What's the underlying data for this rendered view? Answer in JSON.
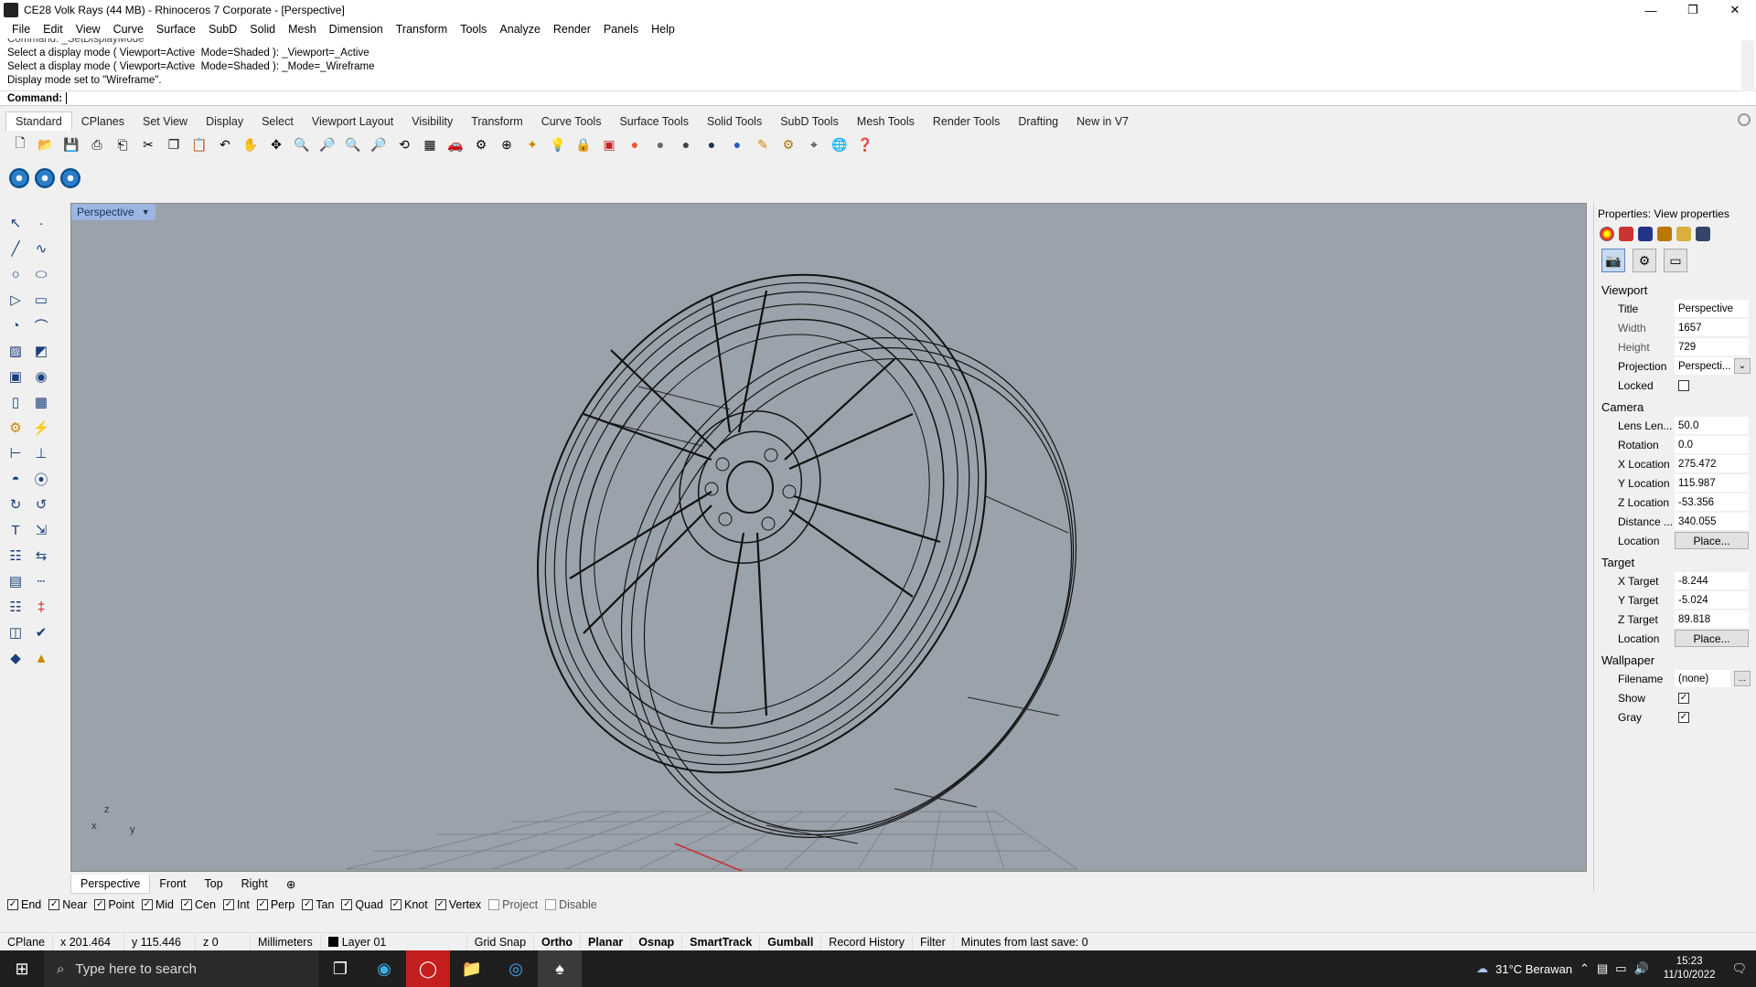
{
  "window": {
    "title": "CE28 Volk Rays (44 MB) - Rhinoceros 7 Corporate - [Perspective]",
    "minimize_icon": "minimize-icon",
    "maximize_icon": "restore-icon",
    "close_icon": "close-icon"
  },
  "menu": [
    "File",
    "Edit",
    "View",
    "Curve",
    "Surface",
    "SubD",
    "Solid",
    "Mesh",
    "Dimension",
    "Transform",
    "Tools",
    "Analyze",
    "Render",
    "Panels",
    "Help"
  ],
  "command_history": {
    "line0": "Command: _SetDisplayMode",
    "line1": "Select a display mode ( Viewport=Active  Mode=Shaded ): _Viewport=_Active",
    "line2": "Select a display mode ( Viewport=Active  Mode=Shaded ): _Mode=_Wireframe",
    "line3": "Display mode set to \"Wireframe\"."
  },
  "command_prompt": {
    "label": "Command:",
    "value": ""
  },
  "toolbar_tabs": [
    "Standard",
    "CPlanes",
    "Set View",
    "Display",
    "Select",
    "Viewport Layout",
    "Visibility",
    "Transform",
    "Curve Tools",
    "Surface Tools",
    "Solid Tools",
    "SubD Tools",
    "Mesh Tools",
    "Render Tools",
    "Drafting",
    "New in V7"
  ],
  "viewport": {
    "title": "Perspective",
    "display_mode": "Wireframe",
    "axes": {
      "z": "z",
      "x": "x",
      "y": "y"
    }
  },
  "view_tabs": [
    "Perspective",
    "Front",
    "Top",
    "Right"
  ],
  "osnaps": [
    {
      "label": "End",
      "checked": true
    },
    {
      "label": "Near",
      "checked": true
    },
    {
      "label": "Point",
      "checked": true
    },
    {
      "label": "Mid",
      "checked": true
    },
    {
      "label": "Cen",
      "checked": true
    },
    {
      "label": "Int",
      "checked": true
    },
    {
      "label": "Perp",
      "checked": true
    },
    {
      "label": "Tan",
      "checked": true
    },
    {
      "label": "Quad",
      "checked": true
    },
    {
      "label": "Knot",
      "checked": true
    },
    {
      "label": "Vertex",
      "checked": true
    },
    {
      "label": "Project",
      "checked": false
    },
    {
      "label": "Disable",
      "checked": false
    }
  ],
  "status": {
    "cplane": "CPlane",
    "x": "x 201.464",
    "y": "y 115.446",
    "z": "z 0",
    "units": "Millimeters",
    "layer": "Layer 01",
    "grid_snap": "Grid Snap",
    "ortho": "Ortho",
    "planar": "Planar",
    "osnap": "Osnap",
    "smarttrack": "SmartTrack",
    "gumball": "Gumball",
    "record_history": "Record History",
    "filter": "Filter",
    "save_info": "Minutes from last save: 0"
  },
  "properties": {
    "title": "Properties: View properties",
    "viewport_section": "Viewport",
    "title_label": "Title",
    "title_value": "Perspective",
    "width_label": "Width",
    "width_value": "1657",
    "height_label": "Height",
    "height_value": "729",
    "projection_label": "Projection",
    "projection_value": "Perspecti...",
    "locked_label": "Locked",
    "locked": false,
    "camera_section": "Camera",
    "lens_label": "Lens Len...",
    "lens_value": "50.0",
    "rotation_label": "Rotation",
    "rotation_value": "0.0",
    "xloc_label": "X Location",
    "xloc_value": "275.472",
    "yloc_label": "Y Location",
    "yloc_value": "115.987",
    "zloc_label": "Z Location",
    "zloc_value": "-53.356",
    "distance_label": "Distance ...",
    "distance_value": "340.055",
    "location_label": "Location",
    "place_button": "Place...",
    "target_section": "Target",
    "xtarget_label": "X Target",
    "xtarget_value": "-8.244",
    "ytarget_label": "Y Target",
    "ytarget_value": "-5.024",
    "ztarget_label": "Z Target",
    "ztarget_value": "89.818",
    "target_location_label": "Location",
    "target_place_button": "Place...",
    "wallpaper_section": "Wallpaper",
    "filename_label": "Filename",
    "filename_value": "(none)",
    "browse_button": "...",
    "show_label": "Show",
    "show": true,
    "gray_label": "Gray",
    "gray": true
  },
  "taskbar": {
    "search_placeholder": "Type here to search",
    "weather": "31°C  Berawan",
    "time": "15:23",
    "date": "11/10/2022"
  }
}
